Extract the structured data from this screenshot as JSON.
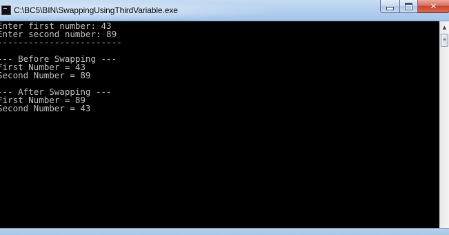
{
  "window": {
    "title": "C:\\BC5\\BIN\\SwappingUsingThirdVariable.exe",
    "app_icon": "console-app-icon",
    "controls": {
      "minimize_icon": "minimize-icon",
      "maximize_icon": "maximize-icon",
      "close_icon": "close-icon",
      "close_glyph": "✕"
    }
  },
  "console": {
    "lines": [
      "Enter first number: 43",
      "Enter second number: 89",
      "------------------------",
      "",
      "--- Before Swapping ---",
      "First Number = 43",
      "Second Number = 89",
      "",
      "--- After Swapping ---",
      "First Number = 89",
      "Second Number = 43"
    ]
  },
  "scrollbar": {
    "up_arrow": "▲"
  },
  "colors": {
    "console_background": "#000000",
    "console_text": "#c0c0c0",
    "close_button": "#c9452e"
  }
}
